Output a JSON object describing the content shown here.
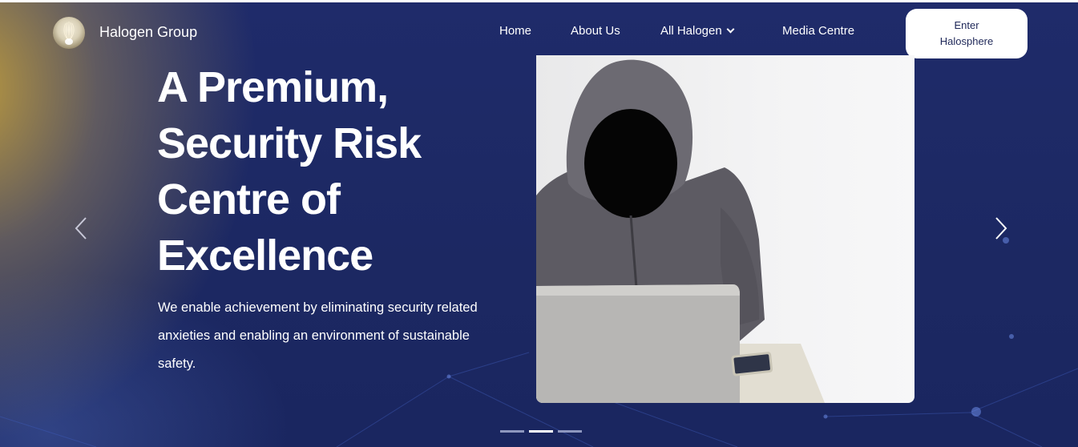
{
  "nav": {
    "brand": "Halogen Group",
    "links": [
      "Home",
      "About Us",
      "All Halogen",
      "Media Centre"
    ],
    "cta_line1": "Enter",
    "cta_line2": "Halosphere"
  },
  "hero": {
    "headline": [
      "A Premium,",
      "Security Risk",
      "Centre of",
      "Excellence"
    ],
    "subtext": [
      "We enable achievement by eliminating security related",
      "anxieties and enabling an environment of sustainable",
      "safety."
    ]
  },
  "carousel": {
    "slides": 3,
    "active_slide": 2
  },
  "icons": {
    "logo": "halogen-logo-icon",
    "dropdown": "chevron-down-icon",
    "prev": "chevron-left-icon",
    "next": "chevron-right-icon"
  },
  "colors": {
    "navy": "#1d2a64",
    "gold": "#c4a03c",
    "white": "#ffffff"
  }
}
